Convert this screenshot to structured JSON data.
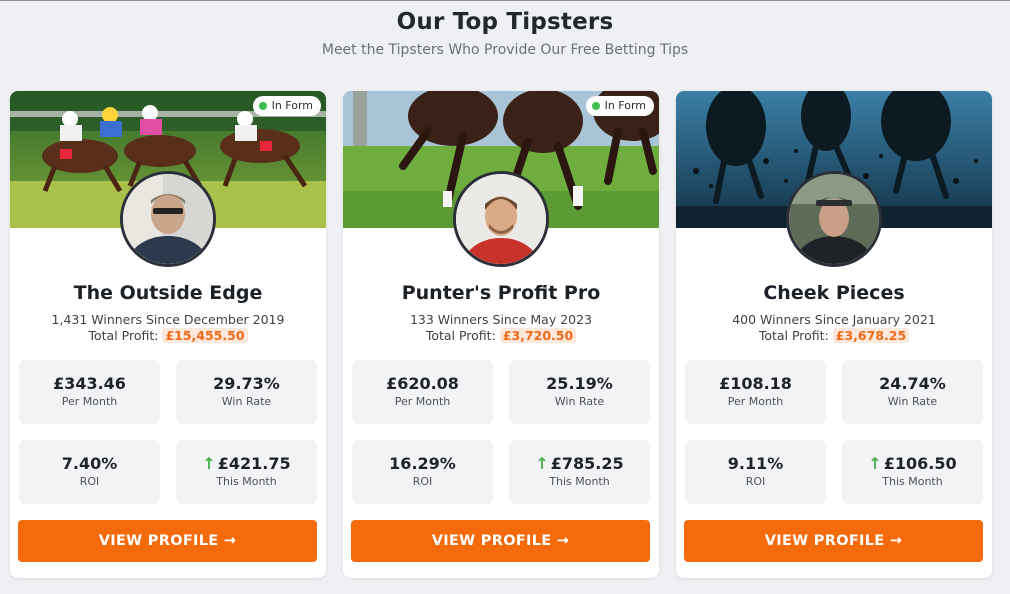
{
  "section": {
    "title": "Our Top Tipsters",
    "subtitle": "Meet the Tipsters Who Provide Our Free Betting Tips"
  },
  "colors": {
    "accent": "#f56a0b",
    "profit_text": "#f06a19",
    "in_form_dot": "#3fbf4f",
    "up_arrow": "#4caf50"
  },
  "tipsters": [
    {
      "name": "The Outside Edge",
      "badge": "In Form",
      "winners": "1,431 Winners Since December 2019",
      "profit_label": "Total Profit:",
      "profit_value": "£15,455.50",
      "stats": [
        {
          "value": "£343.46",
          "label": "Per Month"
        },
        {
          "value": "29.73%",
          "label": "Win Rate"
        },
        {
          "value": "7.40%",
          "label": "ROI"
        },
        {
          "value": "£421.75",
          "label": "This Month",
          "icon": "arrow-up-icon"
        }
      ],
      "button": "VIEW PROFILE →"
    },
    {
      "name": "Punter's Profit Pro",
      "badge": "In Form",
      "winners": "133 Winners Since May 2023",
      "profit_label": "Total Profit:",
      "profit_value": "£3,720.50",
      "stats": [
        {
          "value": "£620.08",
          "label": "Per Month"
        },
        {
          "value": "25.19%",
          "label": "Win Rate"
        },
        {
          "value": "16.29%",
          "label": "ROI"
        },
        {
          "value": "£785.25",
          "label": "This Month",
          "icon": "arrow-up-icon"
        }
      ],
      "button": "VIEW PROFILE →"
    },
    {
      "name": "Cheek Pieces",
      "winners": "400 Winners Since January 2021",
      "profit_label": "Total Profit:",
      "profit_value": "£3,678.25",
      "stats": [
        {
          "value": "£108.18",
          "label": "Per Month"
        },
        {
          "value": "24.74%",
          "label": "Win Rate"
        },
        {
          "value": "9.11%",
          "label": "ROI"
        },
        {
          "value": "£106.50",
          "label": "This Month",
          "icon": "arrow-up-icon"
        }
      ],
      "button": "VIEW PROFILE →"
    }
  ]
}
